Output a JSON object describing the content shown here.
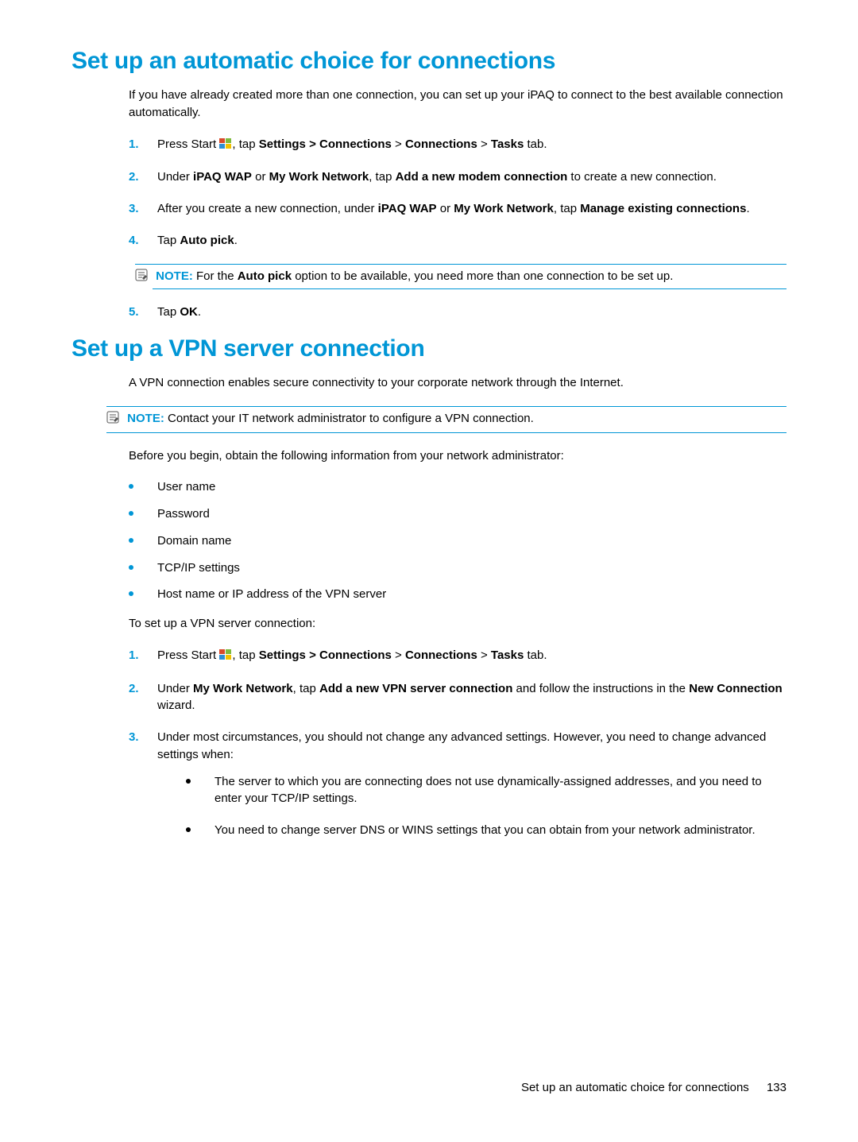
{
  "section1": {
    "heading": "Set up an automatic choice for connections",
    "intro": "If you have already created more than one connection, you can set up your iPAQ to connect to the best available connection automatically.",
    "steps": {
      "s1_a": "Press Start ",
      "s1_b": ", tap ",
      "s1_c": "Settings",
      "s1_d": " > Connections",
      "s1_e": " > ",
      "s1_f": "Connections",
      "s1_g": " > ",
      "s1_h": "Tasks",
      "s1_i": " tab.",
      "s2_a": "Under ",
      "s2_b": "iPAQ WAP",
      "s2_c": " or ",
      "s2_d": "My Work Network",
      "s2_e": ", tap ",
      "s2_f": "Add a new modem connection",
      "s2_g": " to create a new connection.",
      "s3_a": "After you create a new connection, under ",
      "s3_b": "iPAQ WAP",
      "s3_c": " or ",
      "s3_d": "My Work Network",
      "s3_e": ", tap ",
      "s3_f": "Manage existing connections",
      "s3_g": ".",
      "s4_a": "Tap ",
      "s4_b": "Auto pick",
      "s4_c": ".",
      "note_label": "NOTE:",
      "note_a": "For the ",
      "note_b": "Auto pick",
      "note_c": " option to be available, you need more than one connection to be set up.",
      "s5_a": "Tap ",
      "s5_b": "OK",
      "s5_c": "."
    }
  },
  "section2": {
    "heading": "Set up a VPN server connection",
    "intro": "A VPN connection enables secure connectivity to your corporate network through the Internet.",
    "note_label": "NOTE:",
    "note_text": "Contact your IT network administrator to configure a VPN connection.",
    "before": "Before you begin, obtain the following information from your network administrator:",
    "bullets": {
      "b1": "User name",
      "b2": "Password",
      "b3": "Domain name",
      "b4": "TCP/IP settings",
      "b5": "Host name or IP address of the VPN server"
    },
    "toset": "To set up a VPN server connection:",
    "steps": {
      "s1_a": "Press Start ",
      "s1_b": ", tap ",
      "s1_c": "Settings",
      "s1_d": " > Connections",
      "s1_e": " > ",
      "s1_f": "Connections",
      "s1_g": " > ",
      "s1_h": "Tasks",
      "s1_i": " tab.",
      "s2_a": "Under ",
      "s2_b": "My Work Network",
      "s2_c": ", tap ",
      "s2_d": "Add a new VPN server connection",
      "s2_e": " and follow the instructions in the ",
      "s2_f": "New Connection",
      "s2_g": " wizard.",
      "s3_a": "Under most circumstances, you should not change any advanced settings. However, you need to change advanced settings when:",
      "s3_sub1": "The server to which you are connecting does not use dynamically-assigned addresses, and you need to enter your TCP/IP settings.",
      "s3_sub2": "You need to change server DNS or WINS settings that you can obtain from your network administrator."
    }
  },
  "footer": {
    "title": "Set up an automatic choice for connections",
    "page": "133"
  },
  "numbers": {
    "n1": "1.",
    "n2": "2.",
    "n3": "3.",
    "n4": "4.",
    "n5": "5."
  }
}
